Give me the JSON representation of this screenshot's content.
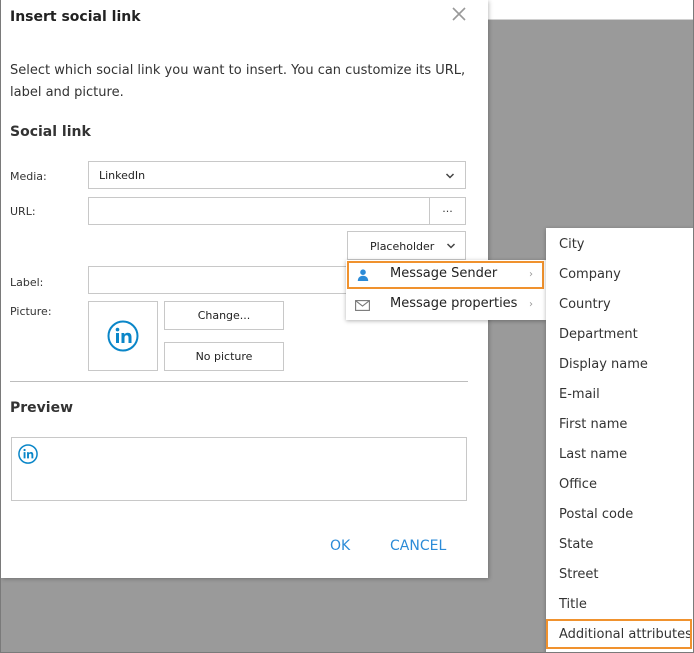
{
  "dialog": {
    "title": "Insert social link",
    "intro": "Select which social link you want to insert. You can customize its URL, label and picture."
  },
  "social_link": {
    "heading": "Social link",
    "media_label": "Media:",
    "media_value": "LinkedIn",
    "url_label": "URL:",
    "url_value": "",
    "url_browse_label": "...",
    "placeholder_label": "Placeholder",
    "label_label": "Label:",
    "label_value": "",
    "picture_label": "Picture:",
    "change_label": "Change...",
    "no_picture_label": "No picture"
  },
  "preview": {
    "heading": "Preview"
  },
  "actions": {
    "ok": "OK",
    "cancel": "CANCEL"
  },
  "placeholder_menu": {
    "items": [
      {
        "label": "Message Sender",
        "icon": "person-icon"
      },
      {
        "label": "Message properties",
        "icon": "envelope-icon"
      }
    ]
  },
  "sender_submenu": {
    "items": [
      "City",
      "Company",
      "Country",
      "Department",
      "Display name",
      "E-mail",
      "First name",
      "Last name",
      "Office",
      "Postal code",
      "State",
      "Street",
      "Title",
      "Additional attributes"
    ]
  },
  "colors": {
    "accent": "#2b8bd8",
    "highlight": "#f0922e",
    "linkedin": "#0a86c8"
  }
}
